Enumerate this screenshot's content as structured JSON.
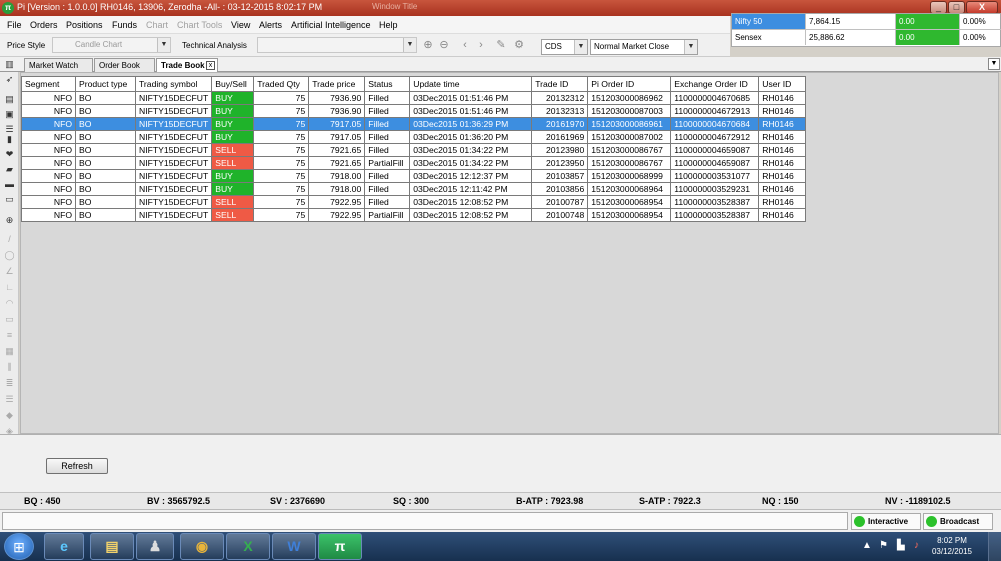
{
  "window": {
    "title": "Pi [Version : 1.0.0.0] RH0146, 13906, Zerodha -All- : 03-12-2015 8:02:17 PM",
    "ghost_title": "Window Title",
    "logo": "π",
    "controls": [
      "_",
      "□",
      "X"
    ]
  },
  "menu": [
    "File",
    "Orders",
    "Positions",
    "Funds",
    "Chart",
    "Chart Tools",
    "View",
    "Alerts",
    "Artificial Intelligence",
    "Help"
  ],
  "menu_disabled": [
    "Chart",
    "Chart Tools"
  ],
  "ticker": [
    {
      "name": "Nifty 50",
      "value": "7,864.15",
      "change": "0.00",
      "pct": "0.00%"
    },
    {
      "name": "Sensex",
      "value": "25,886.62",
      "change": "0.00",
      "pct": "0.00%"
    }
  ],
  "toolbar": {
    "price_style_label": "Price Style",
    "price_style_value": "Candle Chart",
    "technical_analysis_label": "Technical Analysis",
    "technical_analysis_value": "",
    "exchange_value": "CDS",
    "order_type_value": "Normal Market Close"
  },
  "tabs": [
    "Market Watch",
    "Order Book",
    "Trade Book"
  ],
  "active_tab": "Trade Book",
  "tab_close": "x",
  "columns": [
    "Segment",
    "Product type",
    "Trading symbol",
    "Buy/Sell",
    "Traded Qty",
    "Trade price",
    "Status",
    "Update time",
    "Trade ID",
    "Pi Order ID",
    "Exchange Order ID",
    "User ID"
  ],
  "rows": [
    [
      "NFO",
      "BO",
      "NIFTY15DECFUT",
      "BUY",
      "75",
      "7936.90",
      "Filled",
      "03Dec2015 01:51:46 PM",
      "20132312",
      "151203000086962",
      "1100000004670685",
      "RH0146"
    ],
    [
      "NFO",
      "BO",
      "NIFTY15DECFUT",
      "BUY",
      "75",
      "7936.90",
      "Filled",
      "03Dec2015 01:51:46 PM",
      "20132313",
      "151203000087003",
      "1100000004672913",
      "RH0146"
    ],
    [
      "NFO",
      "BO",
      "NIFTY15DECFUT",
      "BUY",
      "75",
      "7917.05",
      "Filled",
      "03Dec2015 01:36:29 PM",
      "20161970",
      "151203000086961",
      "1100000004670684",
      "RH0146"
    ],
    [
      "NFO",
      "BO",
      "NIFTY15DECFUT",
      "BUY",
      "75",
      "7917.05",
      "Filled",
      "03Dec2015 01:36:20 PM",
      "20161969",
      "151203000087002",
      "1100000004672912",
      "RH0146"
    ],
    [
      "NFO",
      "BO",
      "NIFTY15DECFUT",
      "SELL",
      "75",
      "7921.65",
      "Filled",
      "03Dec2015 01:34:22 PM",
      "20123980",
      "151203000086767",
      "1100000004659087",
      "RH0146"
    ],
    [
      "NFO",
      "BO",
      "NIFTY15DECFUT",
      "SELL",
      "75",
      "7921.65",
      "PartialFill",
      "03Dec2015 01:34:22 PM",
      "20123950",
      "151203000086767",
      "1100000004659087",
      "RH0146"
    ],
    [
      "NFO",
      "BO",
      "NIFTY15DECFUT",
      "BUY",
      "75",
      "7918.00",
      "Filled",
      "03Dec2015 12:12:37 PM",
      "20103857",
      "151203000068999",
      "1100000003531077",
      "RH0146"
    ],
    [
      "NFO",
      "BO",
      "NIFTY15DECFUT",
      "BUY",
      "75",
      "7918.00",
      "Filled",
      "03Dec2015 12:11:42 PM",
      "20103856",
      "151203000068964",
      "1100000003529231",
      "RH0146"
    ],
    [
      "NFO",
      "BO",
      "NIFTY15DECFUT",
      "SELL",
      "75",
      "7922.95",
      "Filled",
      "03Dec2015 12:08:52 PM",
      "20100787",
      "151203000068954",
      "1100000003528387",
      "RH0146"
    ],
    [
      "NFO",
      "BO",
      "NIFTY15DECFUT",
      "SELL",
      "75",
      "7922.95",
      "PartialFill",
      "03Dec2015 12:08:52 PM",
      "20100748",
      "151203000068954",
      "1100000003528387",
      "RH0146"
    ]
  ],
  "selected_row": 2,
  "refresh_label": "Refresh",
  "stats": [
    {
      "label": "BQ",
      "value": "450"
    },
    {
      "label": "BV",
      "value": "3565792.5"
    },
    {
      "label": "SV",
      "value": "2376690"
    },
    {
      "label": "SQ",
      "value": "300"
    },
    {
      "label": "B-ATP",
      "value": "7923.98"
    },
    {
      "label": "S-ATP",
      "value": "7922.3"
    },
    {
      "label": "NQ",
      "value": "150"
    },
    {
      "label": "NV",
      "value": "-1189102.5"
    }
  ],
  "connections": {
    "interactive": "Interactive",
    "broadcast": "Broadcast"
  },
  "taskbar": {
    "apps": [
      {
        "name": "internet-explorer",
        "glyph": "e",
        "color": "#5cc8ff"
      },
      {
        "name": "file-explorer",
        "glyph": "▤",
        "color": "#f2d26b"
      },
      {
        "name": "user-app",
        "glyph": "♟",
        "color": "#dddddd"
      },
      {
        "name": "chrome",
        "glyph": "◉",
        "color": "#e8b43a"
      },
      {
        "name": "excel",
        "glyph": "X",
        "color": "#35b04f"
      },
      {
        "name": "word",
        "glyph": "W",
        "color": "#3f7fd8"
      },
      {
        "name": "pi-app",
        "glyph": "π",
        "color": "#ffffff"
      }
    ],
    "time": "8:02 PM",
    "date": "03/12/2015"
  },
  "colors": {
    "buy": "#1fb32a",
    "sell": "#ef5a45",
    "selected": "#3d8ee0",
    "ticker_positive": "#2fb82f",
    "ticker_index": "#3d8ee0"
  }
}
